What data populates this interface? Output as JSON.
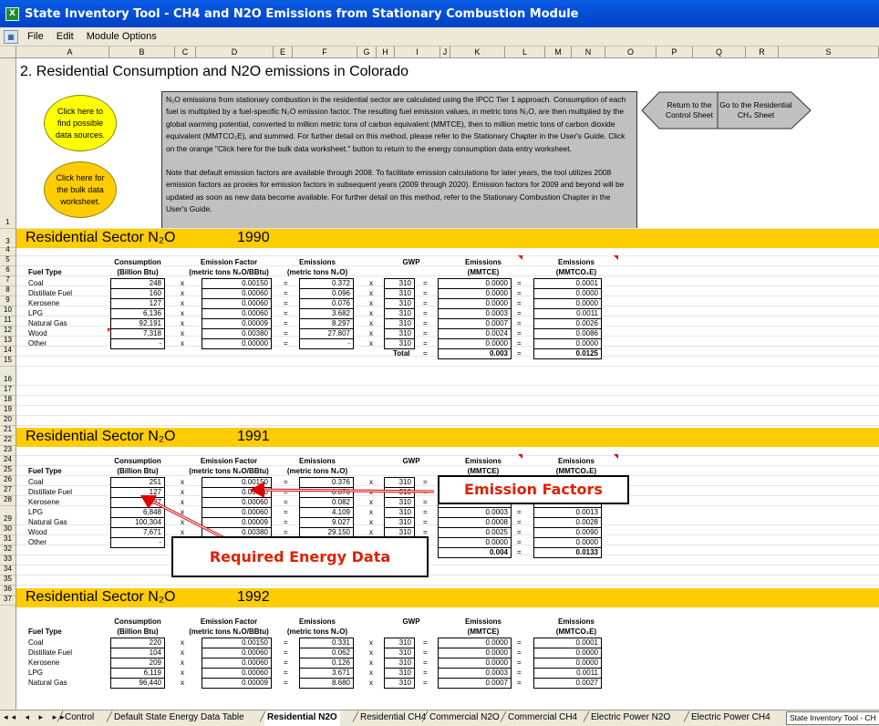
{
  "window": {
    "title": "State Inventory Tool - CH4 and N2O Emissions from Stationary Combustion Module"
  },
  "menu": {
    "file": "File",
    "edit": "Edit",
    "module": "Module Options"
  },
  "columns": [
    "A",
    "B",
    "C",
    "D",
    "E",
    "F",
    "G",
    "H",
    "I",
    "J",
    "K",
    "L",
    "M",
    "N",
    "O",
    "P",
    "Q",
    "R",
    "S"
  ],
  "sheet_title": "2. Residential Consumption and N2O emissions in Colorado",
  "buttons": {
    "sources": "Click here to find possible data sources.",
    "bulk": "Click here for the bulk data worksheet.",
    "return": "Return to the Control Sheet",
    "goto": "Go to the Residential CH₄ Sheet"
  },
  "info": {
    "p1": "N₂O emissions from stationary combustion in the residential sector are calculated using the IPCC Tier 1 approach.  Consumption of each fuel is multiplied by a fuel-specific N₂O emission factor.  The resulting fuel emission values, in metric tons N₂O, are then multiplied by the global warming potential, converted to million metric tons of carbon equivalent (MMTCE), then to million metric tons of carbon dioxide equivalent (MMTCO₂E), and summed.  For further detail on this method, please refer to the Stationary Chapter in the User's Guide. Click on the orange \"Click here for the bulk data worksheet.\" button to return to the energy consumption data entry worksheet.",
    "p2": "Note that default emission factors are available through 2008.  To facilitate emission calculations for later years, the tool utilizes 2008 emission factors as proxies for emission factors in subsequent years (2009 through 2020).  Emission factors for 2009 and beyond will be updated as soon as new data become available.  For further detail on this method, refer to the Stationary Combustion Chapter in the User's Guide."
  },
  "section_title": "Residential Sector N₂O",
  "headers": {
    "consumption1": "Consumption",
    "consumption2": "(Billion Btu)",
    "ef1": "Emission Factor",
    "ef2": "(metric tons N₂O/BBtu)",
    "em1": "Emissions",
    "em2": "(metric tons N₂O)",
    "gwp": "GWP",
    "mmtce1": "Emissions",
    "mmtce2": "(MMTCE)",
    "mmtco1": "Emissions",
    "mmtco2": "(MMTCO₂E)",
    "fuel": "Fuel Type",
    "total": "Total"
  },
  "ops": {
    "x": "x",
    "eq": "="
  },
  "fuels": [
    "Coal",
    "Distillate Fuel",
    "Kerosene",
    "LPG",
    "Natural Gas",
    "Wood",
    "Other"
  ],
  "years": [
    {
      "year": "1990",
      "consumption": [
        "248",
        "160",
        "127",
        "6,136",
        "92,191",
        "7,318",
        "-"
      ],
      "factor": [
        "0.00150",
        "0.00060",
        "0.00060",
        "0.00060",
        "0.00009",
        "0.00380",
        "0.00000"
      ],
      "emissions": [
        "0.372",
        "0.096",
        "0.076",
        "3.682",
        "8.297",
        "27.807",
        "-"
      ],
      "gwp": [
        "310",
        "310",
        "310",
        "310",
        "310",
        "310",
        "310"
      ],
      "mmtce": [
        "0.0000",
        "0.0000",
        "0.0000",
        "0.0003",
        "0.0007",
        "0.0024",
        "0.0000"
      ],
      "mmtco2e": [
        "0.0001",
        "0.0000",
        "0.0000",
        "0.0011",
        "0.0026",
        "0.0086",
        "0.0000"
      ],
      "total_mmtce": "0.003",
      "total_mmtco2e": "0.0125"
    },
    {
      "year": "1991",
      "consumption": [
        "251",
        "127",
        "137",
        "6,848",
        "100,304",
        "7,671",
        "-"
      ],
      "factor": [
        "0.00150",
        "0.00060",
        "0.00060",
        "0.00060",
        "0.00009",
        "0.00380",
        "0.00000"
      ],
      "emissions": [
        "0.376",
        "0.076",
        "0.082",
        "4.109",
        "9.027",
        "29.150",
        "-"
      ],
      "gwp": [
        "310",
        "310",
        "310",
        "310",
        "310",
        "310",
        "310"
      ],
      "mmtce": [
        "0.0000",
        "0.0000",
        "0.0000",
        "0.0003",
        "0.0008",
        "0.0025",
        "0.0000"
      ],
      "mmtco2e": [
        "0.0001",
        "0.0000",
        "0.0000",
        "0.0013",
        "0.0028",
        "0.0090",
        "0.0000"
      ],
      "total_mmtce": "0.004",
      "total_mmtco2e": "0.0133"
    },
    {
      "year": "1992",
      "consumption": [
        "220",
        "104",
        "209",
        "6,119",
        "96,440"
      ],
      "factor": [
        "0.00150",
        "0.00060",
        "0.00060",
        "0.00060",
        "0.00009"
      ],
      "emissions": [
        "0.331",
        "0.062",
        "0.126",
        "3.671",
        "8.680"
      ],
      "gwp": [
        "310",
        "310",
        "310",
        "310",
        "310"
      ],
      "mmtce": [
        "0.0000",
        "0.0000",
        "0.0000",
        "0.0003",
        "0.0007"
      ],
      "mmtco2e": [
        "0.0001",
        "0.0000",
        "0.0000",
        "0.0011",
        "0.0027"
      ]
    }
  ],
  "callouts": {
    "ef": "Emission Factors",
    "energy": "Required Energy Data"
  },
  "tabs": [
    "Control",
    "Default State Energy Data Table",
    "Residential N2O",
    "Residential CH4",
    "Commercial N2O",
    "Commercial CH4",
    "Electric Power N2O",
    "Electric Power CH4"
  ],
  "workbook_label": "State Inventory Tool - CH",
  "colors": {
    "band": "#ffcc00",
    "oval_sources": "#ffff00",
    "oval_bulk": "#ffcc00",
    "infobox": "#c0c0c0",
    "callout_text": "#e02000",
    "titlebar": "#0a5ce6"
  }
}
